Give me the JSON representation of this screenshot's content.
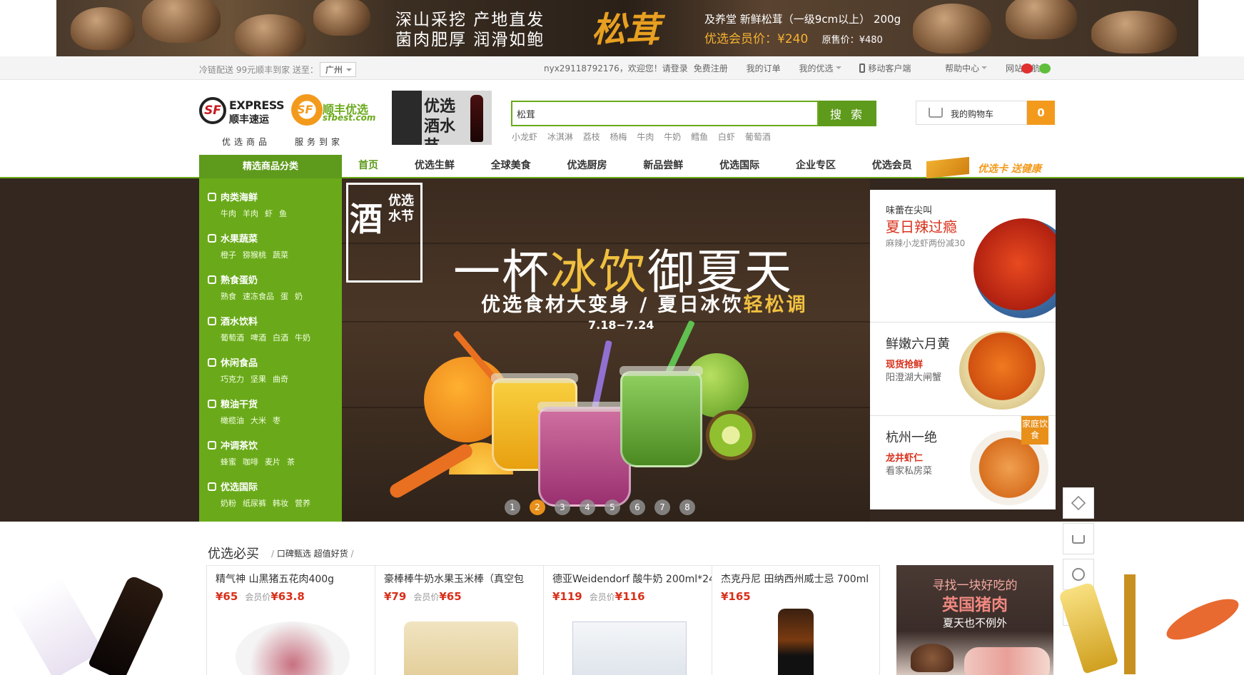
{
  "top_banner": {
    "slogan_line1": "深山采挖 产地直发",
    "slogan_line2": "菌肉肥厚 润滑如鲍",
    "big_title": "松茸",
    "product": "及养堂 新鲜松茸（一级9cm以上） 200g",
    "member_price_label": "优选会员价：",
    "member_price": "¥240",
    "orig_price_label": "原售价：",
    "orig_price": "¥480"
  },
  "util_bar": {
    "delivery_text": "冷链配送 99元顺丰到家 送至：",
    "city": "广州",
    "user": "nyx29118792176，欢迎您！请登录",
    "register": "免费注册",
    "my_orders": "我的订单",
    "my_youxuan": "我的优选",
    "mobile": "移动客户端",
    "help": "帮助中心",
    "site_nav": "网站导航"
  },
  "header": {
    "sf_logo_mark": "SF",
    "sf_logo_en": "EXPRESS",
    "sf_logo_cn": "顺丰速运",
    "best_logo_mark": "SF",
    "best_logo_cn": "顺丰优选",
    "best_logo_url": "sfbest.com",
    "tagline1": "优选商品",
    "tagline2": "服务到家",
    "wine_ad": "优选酒水节",
    "search_value": "松茸",
    "search_button": "搜 索",
    "hot_words": [
      "小龙虾",
      "冰淇淋",
      "荔枝",
      "杨梅",
      "牛肉",
      "牛奶",
      "鳕鱼",
      "白虾",
      "葡萄酒"
    ],
    "cart_label": "我的购物车",
    "cart_count": "0"
  },
  "nav": {
    "category_head": "精选商品分类",
    "items": [
      "首页",
      "优选生鲜",
      "全球美食",
      "优选厨房",
      "新品尝鲜",
      "优选国际",
      "企业专区",
      "优选会员"
    ],
    "card_ad": "优选卡 送健康"
  },
  "categories": [
    {
      "title": "肉类海鲜",
      "subs": [
        "牛肉",
        "羊肉",
        "虾",
        "鱼"
      ]
    },
    {
      "title": "水果蔬菜",
      "subs": [
        "橙子",
        "猕猴桃",
        "蔬菜"
      ]
    },
    {
      "title": "熟食蛋奶",
      "subs": [
        "熟食",
        "速冻食品",
        "蛋",
        "奶"
      ]
    },
    {
      "title": "酒水饮料",
      "subs": [
        "葡萄酒",
        "啤酒",
        "白酒",
        "牛奶"
      ]
    },
    {
      "title": "休闲食品",
      "subs": [
        "巧克力",
        "坚果",
        "曲奇"
      ]
    },
    {
      "title": "粮油干货",
      "subs": [
        "橄榄油",
        "大米",
        "枣"
      ]
    },
    {
      "title": "冲调茶饮",
      "subs": [
        "蜂蜜",
        "咖啡",
        "麦片",
        "茶"
      ]
    },
    {
      "title": "优选国际",
      "subs": [
        "奶粉",
        "纸尿裤",
        "韩妆",
        "营养"
      ]
    }
  ],
  "hero": {
    "logo_char": "酒",
    "logo_text": "优选水节",
    "title_a": "一杯",
    "title_hl": "冰饮",
    "title_b": "御夏天",
    "sub_a": "优选食材大变身 / 夏日冰饮",
    "sub_hl": "轻松调",
    "date": "7.18−7.24",
    "dots": [
      "1",
      "2",
      "3",
      "4",
      "5",
      "6",
      "7",
      "8"
    ],
    "active_dot": 2
  },
  "side_promos": {
    "p1_line1": "味蕾在尖叫",
    "p1_line2": "夏日辣过瘾",
    "p1_line3": "麻辣小龙虾两份减30",
    "p2_title": "鲜嫩六月黄",
    "p2_red": "现货抢鲜",
    "p2_gray": "阳澄湖大闸蟹",
    "p3_title": "杭州一绝",
    "p3_red": "龙井虾仁",
    "p3_gray": "看家私房菜",
    "p3_badge": "家庭饮食"
  },
  "section": {
    "title": "优选必买",
    "sub": "口碑甄选  超值好货"
  },
  "products": [
    {
      "name": "精气神 山黑猪五花肉400g",
      "price": "¥65",
      "member_label": "会员价",
      "member_price": "¥63.8"
    },
    {
      "name": "豪棒棒牛奶水果玉米棒（真空包",
      "price": "¥79",
      "member_label": "会员价",
      "member_price": "¥65"
    },
    {
      "name": "德亚Weidendorf 酸牛奶 200ml*24",
      "price": "¥119",
      "member_label": "会员价",
      "member_price": "¥116"
    },
    {
      "name": "杰克丹尼 田纳西州威士忌 700ml",
      "price": "¥165",
      "member_label": "",
      "member_price": ""
    }
  ],
  "uk_ad": {
    "line1": "寻找一块好吃的",
    "line2": "英国猪肉",
    "line3": "夏天也不例外"
  }
}
